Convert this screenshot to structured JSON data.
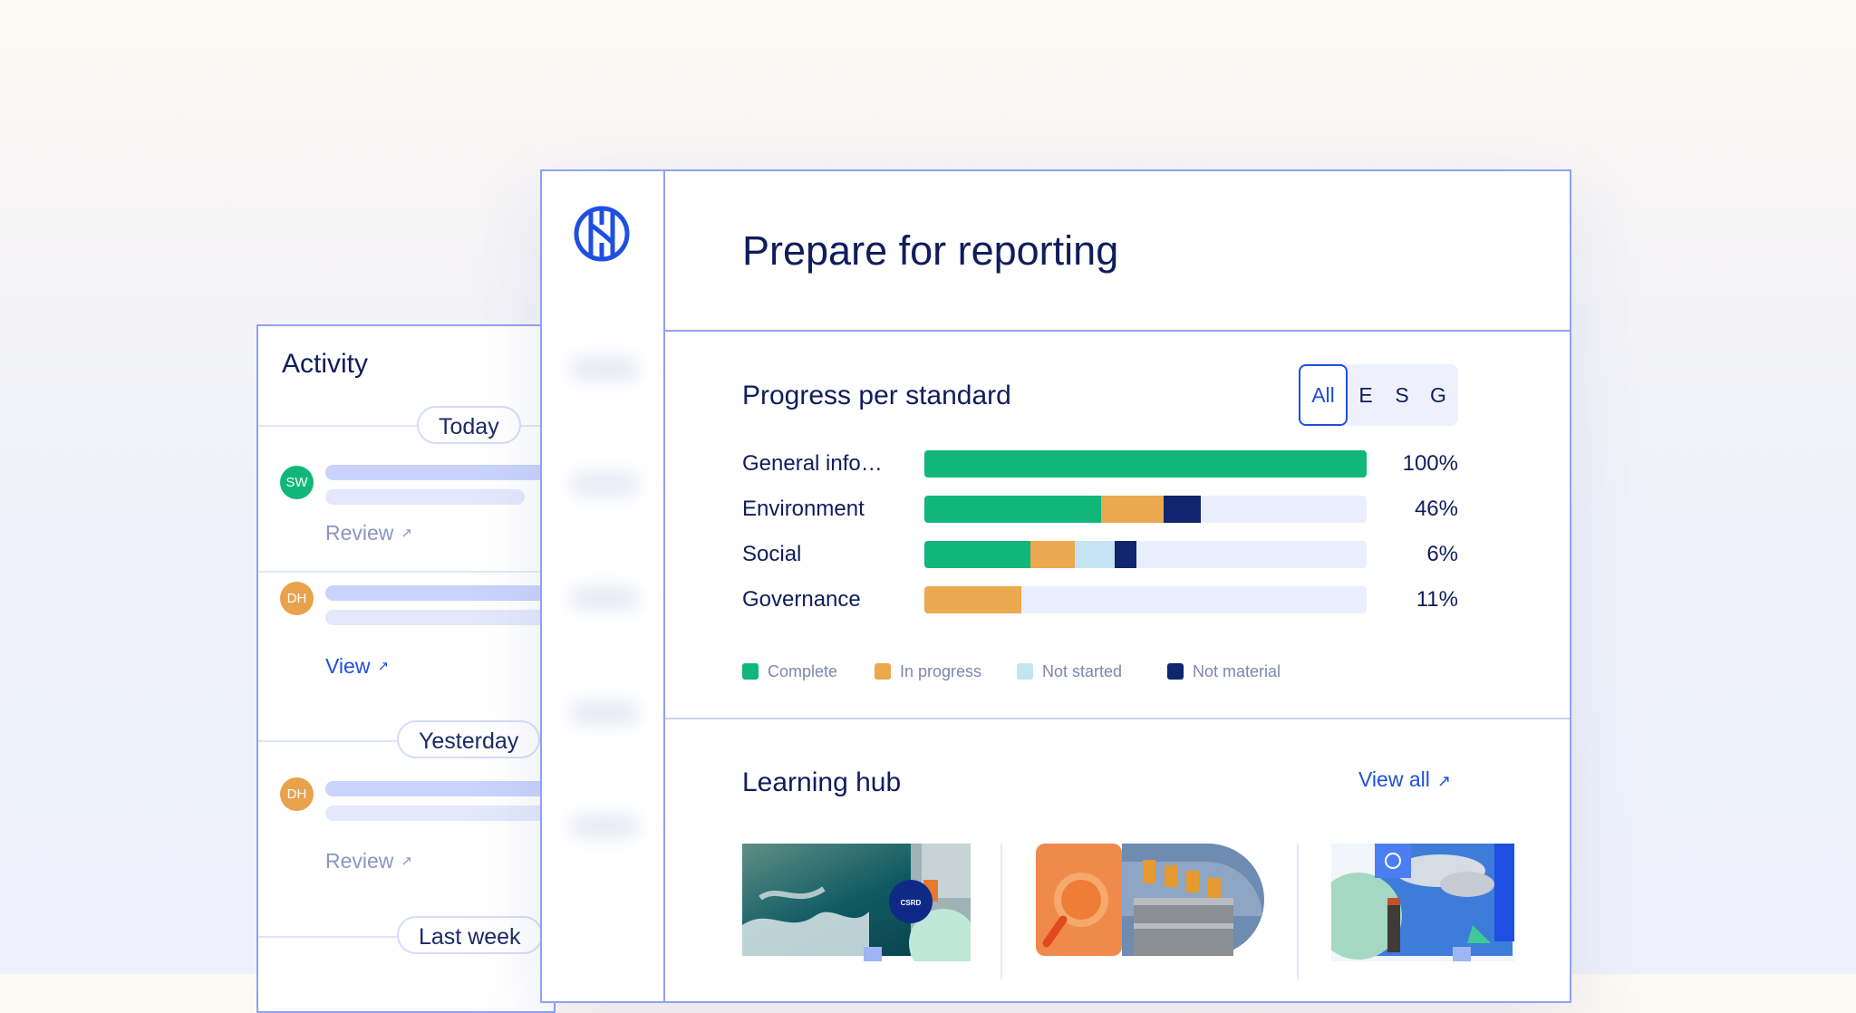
{
  "activity": {
    "title": "Activity",
    "groups": [
      {
        "date": "Today"
      },
      {
        "date": "Yesterday"
      },
      {
        "date": "Last week"
      }
    ],
    "items": [
      {
        "initials": "SW",
        "color": "#11b67a",
        "action": "Review"
      },
      {
        "initials": "DH",
        "color": "#e8a24c",
        "action": "View"
      },
      {
        "initials": "DH",
        "color": "#e8a24c",
        "action": "Review"
      }
    ],
    "arrow_glyph": "↗"
  },
  "main": {
    "title": "Prepare for reporting",
    "logo_icon": "globe-icon",
    "progress": {
      "title": "Progress per standard",
      "tabs": [
        "All",
        "E",
        "S",
        "G"
      ],
      "active_tab": "All",
      "rows": [
        {
          "label": "General info…",
          "pct_text": "100%",
          "complete": 1.0,
          "in_progress": 0.0,
          "not_started": 0.0,
          "not_material": 0.0
        },
        {
          "label": "Environment",
          "pct_text": "46%",
          "complete": 0.4,
          "in_progress": 0.14,
          "not_started": 0.0,
          "not_material": 0.085
        },
        {
          "label": "Social",
          "pct_text": "6%",
          "complete": 0.24,
          "in_progress": 0.1,
          "not_started": 0.09,
          "not_material": 0.05
        },
        {
          "label": "Governance",
          "pct_text": "11%",
          "complete": 0.0,
          "in_progress": 0.22,
          "not_started": 0.0,
          "not_material": 0.0
        }
      ],
      "legend": [
        {
          "label": "Complete",
          "color": "#11b67a"
        },
        {
          "label": "In progress",
          "color": "#eba84f"
        },
        {
          "label": "Not started",
          "color": "#c4e3f3"
        },
        {
          "label": "Not material",
          "color": "#0f256e"
        }
      ]
    },
    "learning_hub": {
      "title": "Learning hub",
      "view_all": "View all",
      "arrow_glyph": "↗",
      "card1_badge": "CSRD"
    }
  },
  "colors": {
    "accent": "#1f4fe0",
    "navy": "#0f1d5c",
    "border": "#8fa2f3"
  }
}
